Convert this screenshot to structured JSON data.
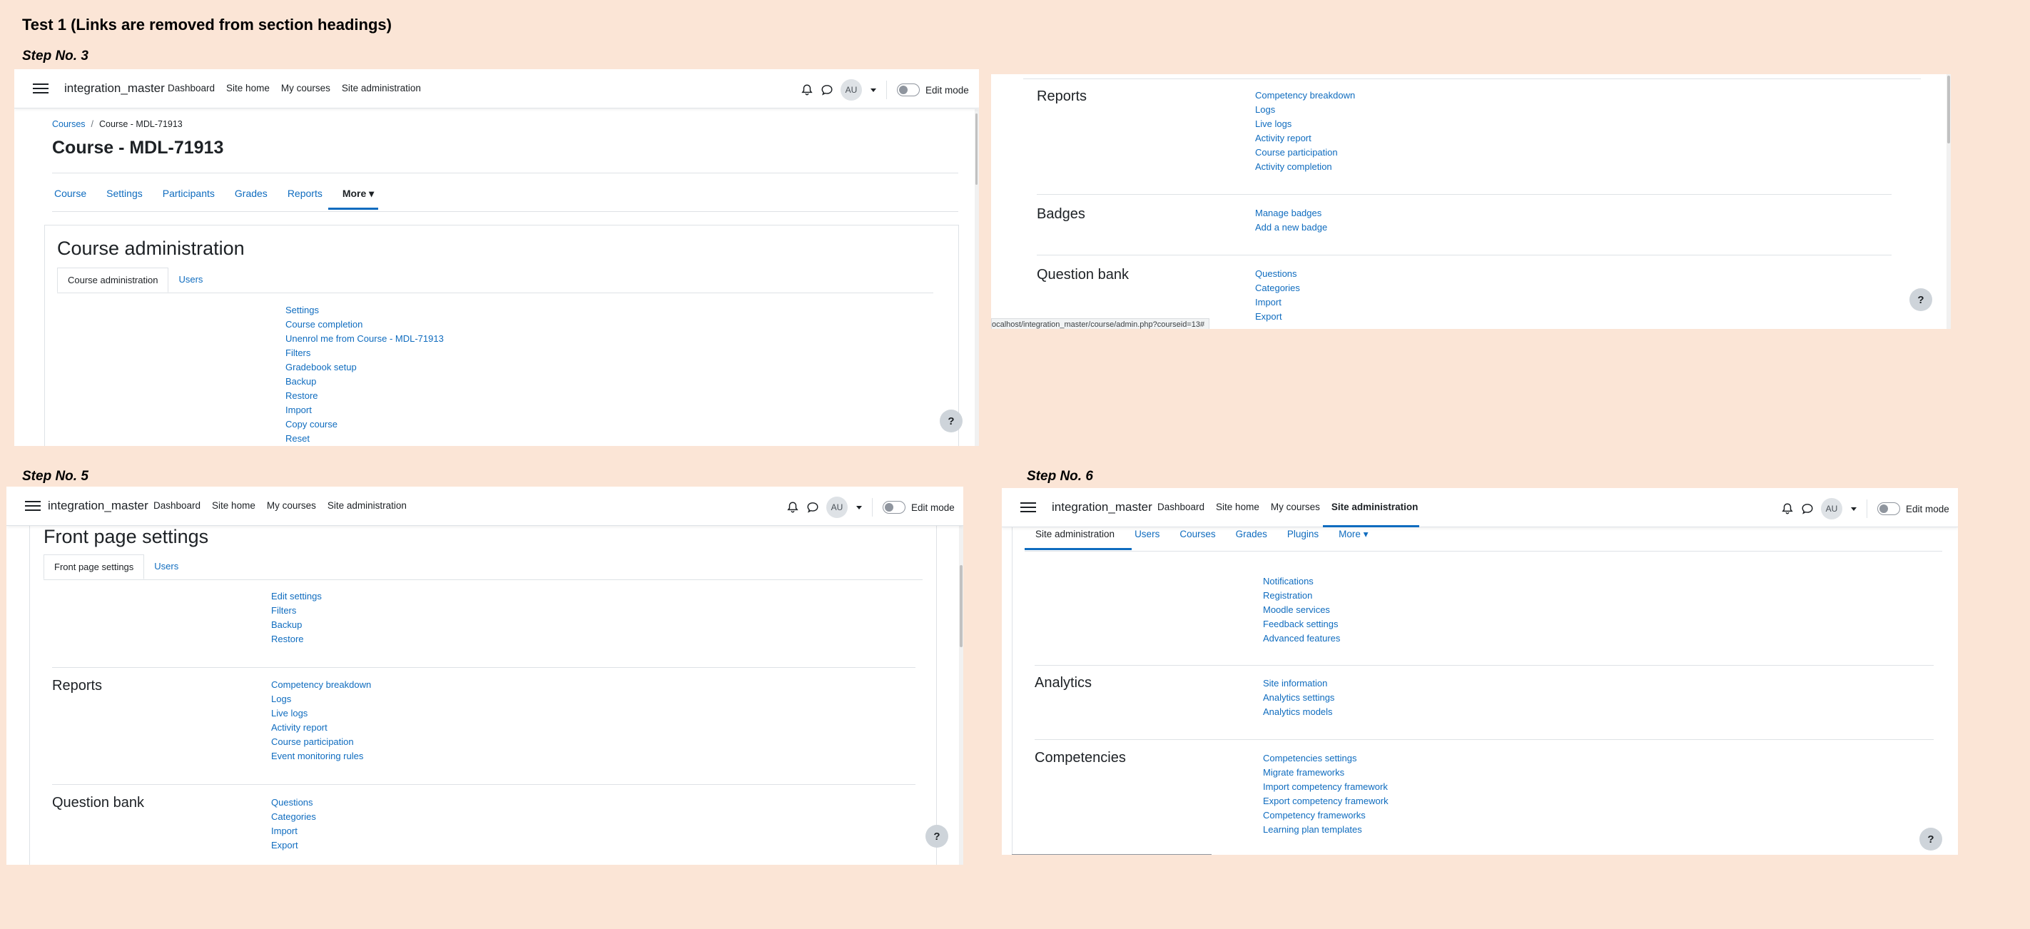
{
  "doc_title": "Test 1 (Links are removed from section headings)",
  "steps": {
    "s3": "Step No. 3",
    "s5": "Step No. 5",
    "s6": "Step No. 6"
  },
  "navbar": {
    "site_name": "integration_master",
    "links": [
      "Dashboard",
      "Site home",
      "My courses",
      "Site administration"
    ],
    "avatar": "AU",
    "edit_mode": "Edit mode"
  },
  "shot1": {
    "breadcrumb": [
      "Courses",
      "/",
      "Course - MDL-71913"
    ],
    "page_title": "Course - MDL-71913",
    "tabs": [
      "Course",
      "Settings",
      "Participants",
      "Grades",
      "Reports",
      "More"
    ],
    "panel_title": "Course administration",
    "subtabs": [
      "Course administration",
      "Users"
    ],
    "links": [
      "Settings",
      "Course completion",
      "Unenrol me from Course - MDL-71913",
      "Filters",
      "Gradebook setup",
      "Backup",
      "Restore",
      "Import",
      "Copy course",
      "Reset"
    ]
  },
  "shot2": {
    "sections": [
      {
        "title": "Reports",
        "links": [
          "Competency breakdown",
          "Logs",
          "Live logs",
          "Activity report",
          "Course participation",
          "Activity completion"
        ]
      },
      {
        "title": "Badges",
        "links": [
          "Manage badges",
          "Add a new badge"
        ]
      },
      {
        "title": "Question bank",
        "links": [
          "Questions",
          "Categories",
          "Import",
          "Export"
        ]
      }
    ],
    "status_url": "ocalhost/integration_master/course/admin.php?courseid=13#"
  },
  "shot3": {
    "page_title": "Front page settings",
    "subtabs": [
      "Front page settings",
      "Users"
    ],
    "top_links": [
      "Edit settings",
      "Filters",
      "Backup",
      "Restore"
    ],
    "sections": [
      {
        "title": "Reports",
        "links": [
          "Competency breakdown",
          "Logs",
          "Live logs",
          "Activity report",
          "Course participation",
          "Event monitoring rules"
        ]
      },
      {
        "title": "Question bank",
        "links": [
          "Questions",
          "Categories",
          "Import",
          "Export"
        ]
      }
    ]
  },
  "shot4": {
    "tabs": [
      "Site administration",
      "Users",
      "Courses",
      "Grades",
      "Plugins",
      "More"
    ],
    "top_links": [
      "Notifications",
      "Registration",
      "Moodle services",
      "Feedback settings",
      "Advanced features"
    ],
    "sections": [
      {
        "title": "Analytics",
        "links": [
          "Site information",
          "Analytics settings",
          "Analytics models"
        ]
      },
      {
        "title": "Competencies",
        "links": [
          "Competencies settings",
          "Migrate frameworks",
          "Import competency framework",
          "Export competency framework",
          "Competency frameworks",
          "Learning plan templates"
        ]
      }
    ]
  },
  "help_label": "?",
  "icons": {
    "menu": "hamburger-icon",
    "bell": "bell-icon",
    "chat": "chat-icon",
    "caret": "caret-down-icon",
    "help": "help-icon"
  },
  "colors": {
    "link": "#0f6cbf",
    "background": "#fbe5d6",
    "text": "#1d2125"
  }
}
